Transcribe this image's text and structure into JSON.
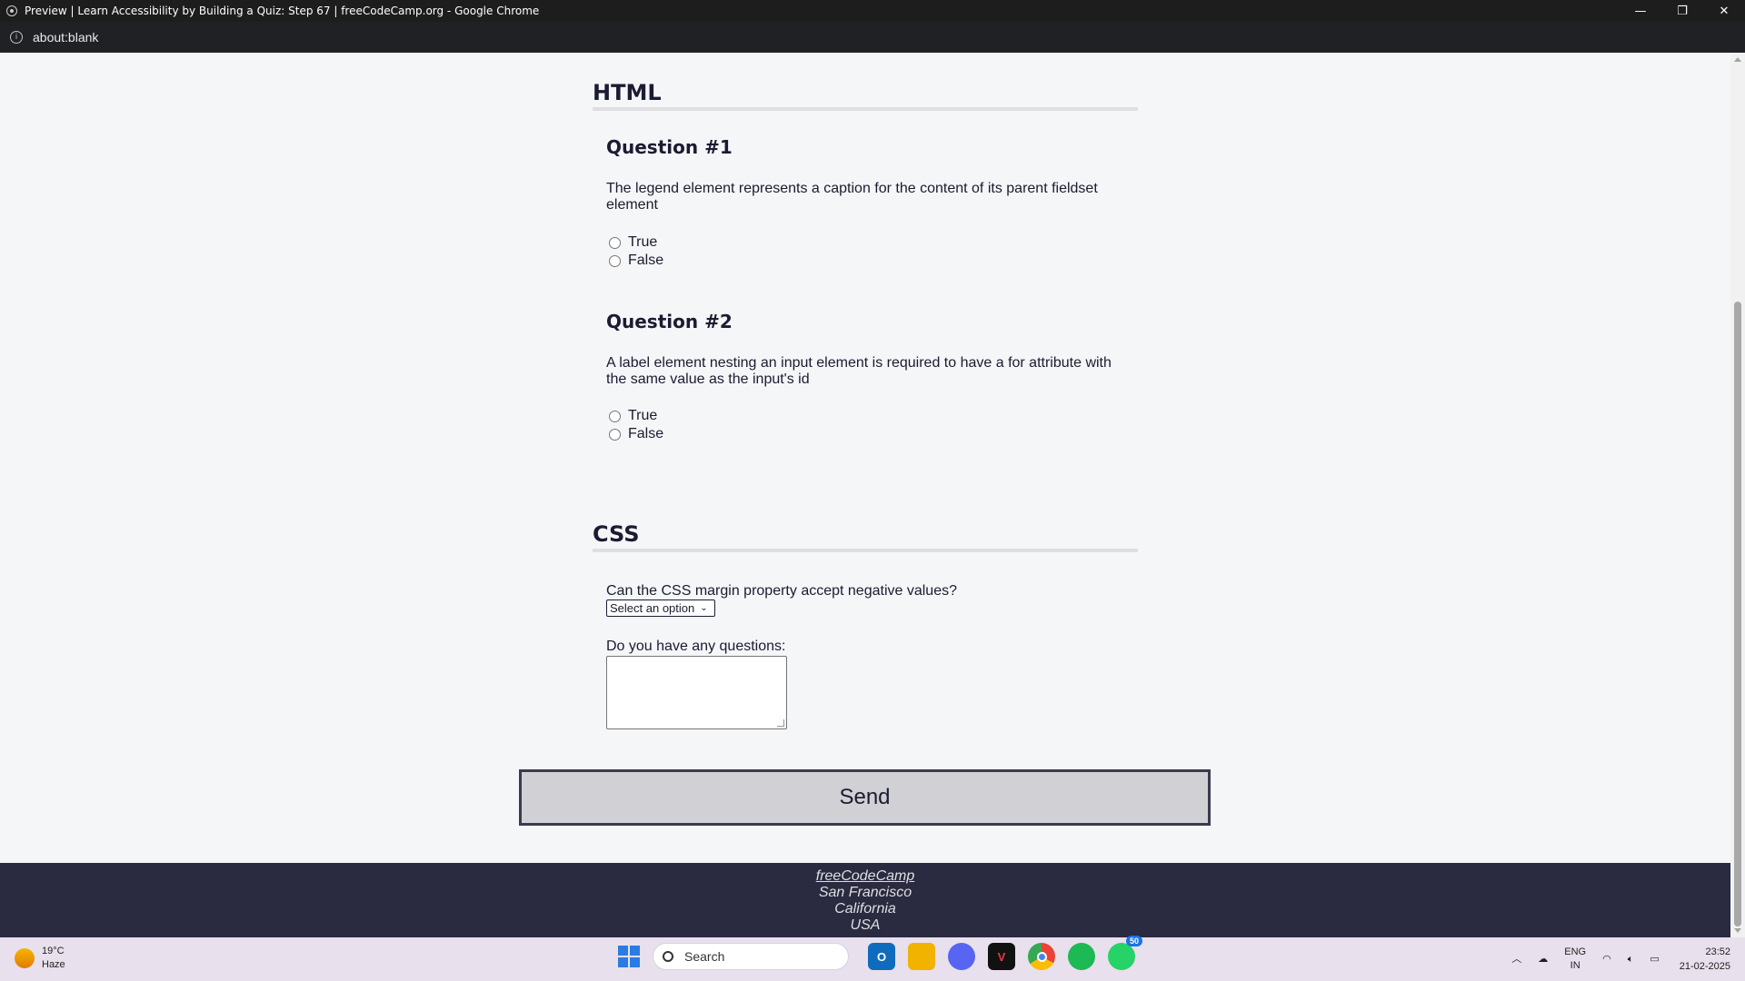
{
  "window": {
    "title": "Preview | Learn Accessibility by Building a Quiz: Step 67 | freeCodeCamp.org - Google Chrome",
    "controls": {
      "minimize": "—",
      "restore": "❐",
      "close": "✕"
    }
  },
  "addressbar": {
    "url": "about:blank"
  },
  "page": {
    "html_section": {
      "heading": "HTML",
      "questions": [
        {
          "heading": "Question #1",
          "text": "The legend element represents a caption for the content of its parent fieldset element",
          "options": [
            "True",
            "False"
          ]
        },
        {
          "heading": "Question #2",
          "text": "A label element nesting an input element is required to have a for attribute with the same value as the input's id",
          "options": [
            "True",
            "False"
          ]
        }
      ]
    },
    "css_section": {
      "heading": "CSS",
      "select_label": "Can the CSS margin property accept negative values?",
      "select_value": "Select an option",
      "textarea_label": "Do you have any questions:"
    },
    "send_button": "Send",
    "footer": {
      "link": "freeCodeCamp",
      "address": [
        "San Francisco",
        "California",
        "USA"
      ]
    }
  },
  "taskbar": {
    "weather": {
      "temp": "19°C",
      "condition": "Haze"
    },
    "search_placeholder": "Search",
    "apps": [
      {
        "name": "outlook",
        "label": "O",
        "color": "#0f6cbd"
      },
      {
        "name": "file-explorer",
        "label": "",
        "color": "#f2b200"
      },
      {
        "name": "discord",
        "label": "",
        "color": "#5865f2"
      },
      {
        "name": "valorant",
        "label": "V",
        "color": "#111111"
      },
      {
        "name": "chrome",
        "label": "",
        "color": "#ea4335"
      },
      {
        "name": "spotify",
        "label": "",
        "color": "#1db954"
      },
      {
        "name": "whatsapp",
        "label": "",
        "color": "#25d366",
        "badge": "50"
      }
    ],
    "tray": {
      "lang_top": "ENG",
      "lang_bottom": "IN",
      "time": "23:52",
      "date": "21-02-2025"
    }
  }
}
